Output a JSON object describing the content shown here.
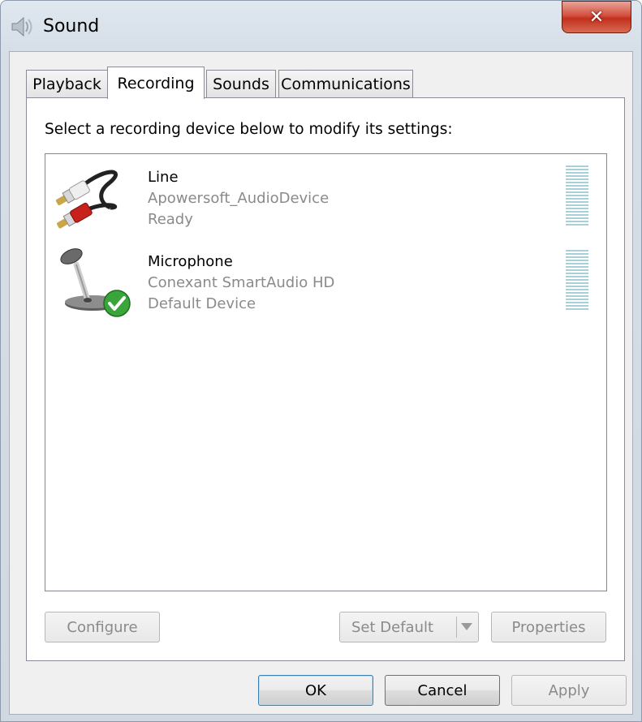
{
  "window": {
    "title": "Sound",
    "close_label": "✕"
  },
  "tabs": [
    {
      "label": "Playback"
    },
    {
      "label": "Recording"
    },
    {
      "label": "Sounds"
    },
    {
      "label": "Communications"
    }
  ],
  "panel": {
    "instruction": "Select a recording device below to modify its settings:"
  },
  "devices": [
    {
      "name": "Line",
      "driver": "Apowersoft_AudioDevice",
      "status": "Ready",
      "icon": "line-in-cable-icon",
      "level": 0
    },
    {
      "name": "Microphone",
      "driver": "Conexant SmartAudio HD",
      "status": "Default Device",
      "icon": "microphone-icon",
      "default": true,
      "level": 0
    }
  ],
  "panel_buttons": {
    "configure": "Configure",
    "set_default": "Set Default",
    "properties": "Properties"
  },
  "dialog_buttons": {
    "ok": "OK",
    "cancel": "Cancel",
    "apply": "Apply"
  },
  "colors": {
    "close_button": "#c8412a",
    "level_meter": "#a9cfd8",
    "default_check": "#3aa53a"
  }
}
